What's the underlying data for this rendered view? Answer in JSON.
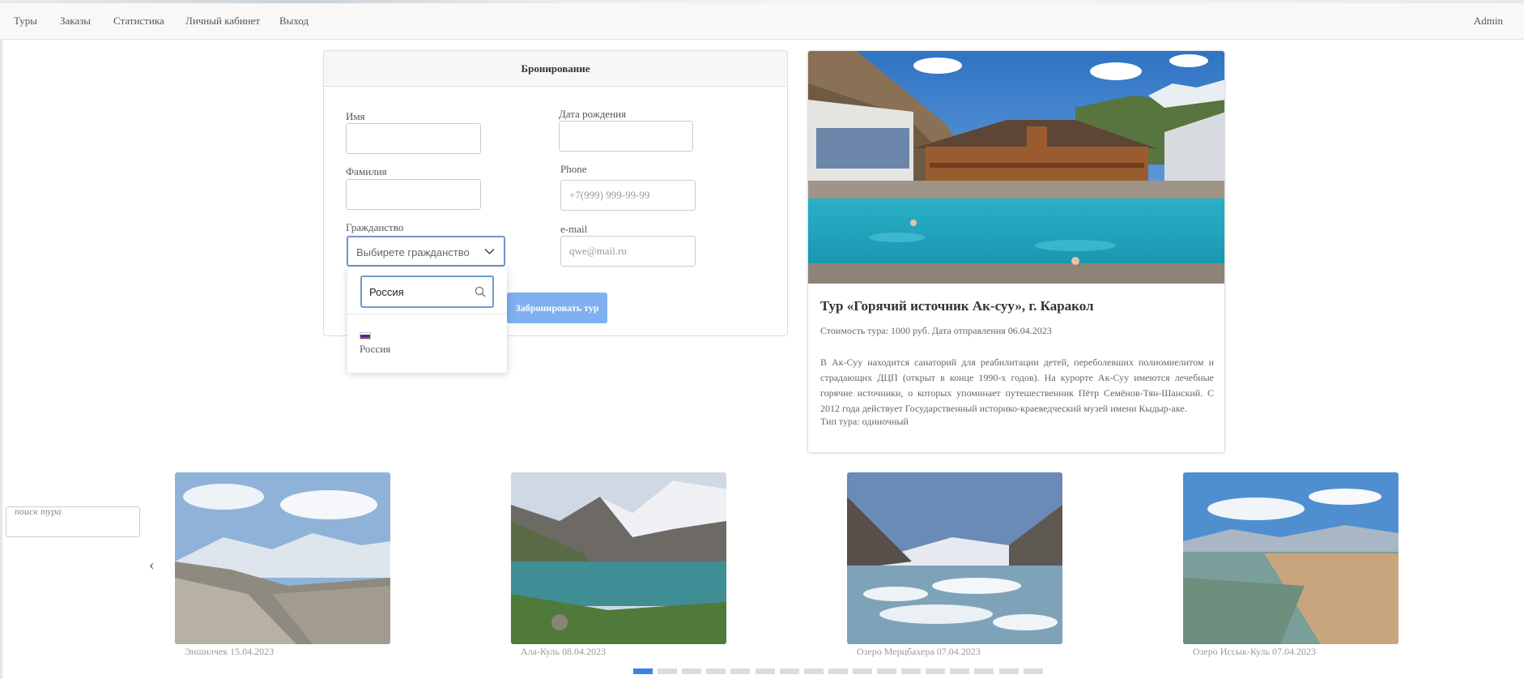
{
  "nav": {
    "items": [
      "Туры",
      "Заказы",
      "Статистика",
      "Личный кабинет",
      "Выход"
    ],
    "user": "Admin"
  },
  "booking": {
    "title": "Бронирование",
    "first_name_label": "Имя",
    "last_name_label": "Фамилия",
    "citizenship_label": "Гражданство",
    "citizenship_placeholder": "Выбирете гражданство",
    "birthdate_label": "Дата рождения",
    "phone_label": "Phone",
    "phone_placeholder": "+7(999) 999-99-99",
    "email_label": "e-mail",
    "email_placeholder": "qwe@mail.ru",
    "submit_label": "Забронировать тур",
    "dropdown": {
      "search_value": "Россия",
      "options": [
        {
          "name": "Россия",
          "flag_colors": [
            "#ffffff",
            "#1c3fae",
            "#d52b1e"
          ]
        }
      ]
    }
  },
  "tour": {
    "title": "Тур «Горячий источник Ак-суу», г. Каракол",
    "meta": "Стоимость тура: 1000 руб. Дата отправления 06.04.2023",
    "description": "В Ак-Суу находится санаторий для реабилитации детей, переболевших полиомиелитом и страдающих ДЦП (открыт в конце 1990-х годов). На курорте Ак-Суу имеются лечебные горячие источники, о которых упоминает путешественник Пётр Семёнов-Тян-Шанский. С 2012 года действует Государственный историко-краеведческий музей имени Кыдыр-аке.",
    "type": "Тип тура: одиночный"
  },
  "search": {
    "placeholder": "поиск тура"
  },
  "carousel": {
    "slides": [
      {
        "caption": "Эншилчек 15.04.2023"
      },
      {
        "caption": "Ала-Куль 08.04.2023"
      },
      {
        "caption": "Озеро Мерцбахера 07.04.2023"
      },
      {
        "caption": "Озеро Иссык-Куль 07.04.2023"
      }
    ],
    "total_pages": 17,
    "active_page": 1
  },
  "colors": {
    "accent": "#3c82e6",
    "submit": "#7fb0f0",
    "focus_border": "#7393c6"
  }
}
